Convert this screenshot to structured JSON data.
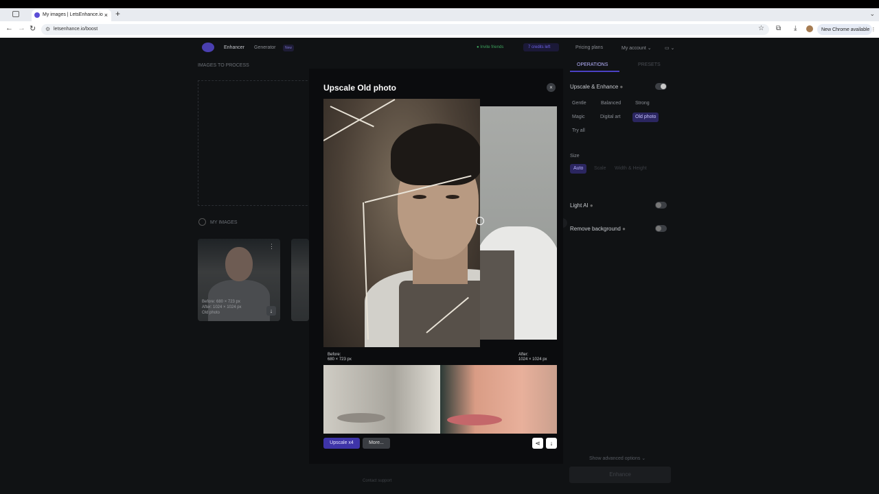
{
  "browser": {
    "tab_title": "My images | LetsEnhance.io",
    "url": "letsenhance.io/boost",
    "chrome_button": "New Chrome available"
  },
  "header": {
    "nav": [
      "Enhancer",
      "Generator"
    ],
    "new_badge": "New",
    "invite": "Invite friends",
    "credits": "7 credits left",
    "pricing": "Pricing plans",
    "account": "My account"
  },
  "left": {
    "images_to_process": "IMAGES TO PROCESS",
    "my_images": "MY IMAGES",
    "thumb_meta": [
      "Before: 680 × 723 px",
      "After: 1024 × 1024 px",
      "Old photo"
    ],
    "contact_support": "Contact support"
  },
  "operations": {
    "tabs": [
      "OPERATIONS",
      "PRESETS"
    ],
    "upscale_enhance": "Upscale & Enhance",
    "styles": [
      "Gentle",
      "Balanced",
      "Strong",
      "Magic",
      "Digital art",
      "Old photo",
      "Try all"
    ],
    "active_style": "Old photo",
    "size_label": "Size",
    "sizes": [
      "Auto",
      "Scale",
      "Width & Height"
    ],
    "light_ai": "Light AI",
    "remove_bg": "Remove background",
    "show_advanced": "Show advanced options",
    "enhance": "Enhance"
  },
  "modal": {
    "title": "Upscale Old photo",
    "before_label": "Before:",
    "before_size": "680 × 723 px",
    "after_label": "After:",
    "after_size": "1024 × 1024 px",
    "upscale_button": "Upscale x4",
    "more_button": "More..."
  },
  "colors": {
    "accent": "#3e34a8",
    "background": "#101214",
    "modal_bg": "#0b0c0e"
  }
}
